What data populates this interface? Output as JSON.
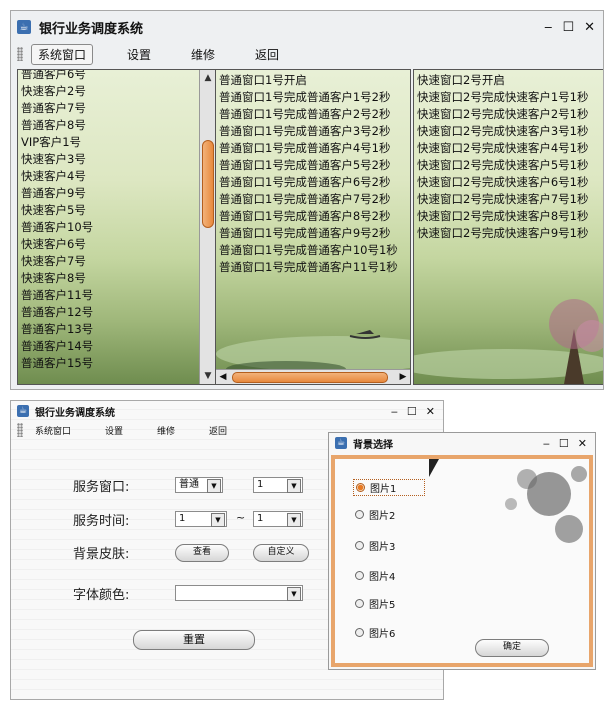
{
  "main_window": {
    "title": "银行业务调度系统",
    "controls": [
      "‒",
      "☐",
      "✕"
    ],
    "menu": [
      "系统窗口",
      "设置",
      "维修",
      "返回"
    ],
    "customers": [
      "普通客户6号",
      "快速客户2号",
      "普通客户7号",
      "普通客户8号",
      "VIP客户1号",
      "快速客户3号",
      "快速客户4号",
      "普通客户9号",
      "快速客户5号",
      "普通客户10号",
      "快速客户6号",
      "快速客户7号",
      "快速客户8号",
      "普通客户11号",
      "普通客户12号",
      "普通客户13号",
      "普通客户14号",
      "普通客户15号"
    ],
    "normal_window_log": [
      "普通窗口1号开启",
      "普通窗口1号完成普通客户1号2秒",
      "普通窗口1号完成普通客户2号2秒",
      "普通窗口1号完成普通客户3号2秒",
      "普通窗口1号完成普通客户4号1秒",
      "普通窗口1号完成普通客户5号2秒",
      "普通窗口1号完成普通客户6号2秒",
      "普通窗口1号完成普通客户7号2秒",
      "普通窗口1号完成普通客户8号2秒",
      "普通窗口1号完成普通客户9号2秒",
      "普通窗口1号完成普通客户10号1秒",
      "普通窗口1号完成普通客户11号1秒"
    ],
    "fast_window_log": [
      "快速窗口2号开启",
      "快速窗口2号完成快速客户1号1秒",
      "快速窗口2号完成快速客户2号1秒",
      "快速窗口2号完成快速客户3号1秒",
      "快速窗口2号完成快速客户4号1秒",
      "快速窗口2号完成快速客户5号1秒",
      "快速窗口2号完成快速客户6号1秒",
      "快速窗口2号完成快速客户7号1秒",
      "快速窗口2号完成快速客户8号1秒",
      "快速窗口2号完成快速客户9号1秒"
    ]
  },
  "settings_window": {
    "title": "银行业务调度系统",
    "controls": [
      "‒",
      "☐",
      "✕"
    ],
    "menu": [
      "系统窗口",
      "设置",
      "维修",
      "返回"
    ],
    "service_window_label": "服务窗口:",
    "service_type": "普通",
    "service_number": "1",
    "service_time_label": "服务时间:",
    "time_from": "1",
    "time_sep": "~",
    "time_to": "1",
    "skin_label": "背景皮肤:",
    "view_button": "查看",
    "custom_button": "自定义",
    "font_color_label": "字体颜色:",
    "font_color_value": "",
    "reset_button": "重置"
  },
  "bg_dialog": {
    "title": "背景选择",
    "controls": [
      "‒",
      "☐",
      "✕"
    ],
    "options": [
      "图片1",
      "图片2",
      "图片3",
      "图片4",
      "图片5",
      "图片6"
    ],
    "selected_index": 0,
    "confirm_button": "确定"
  },
  "colors": {
    "accent_orange": "#e8893d",
    "scroll_border": "#b45f1e"
  }
}
